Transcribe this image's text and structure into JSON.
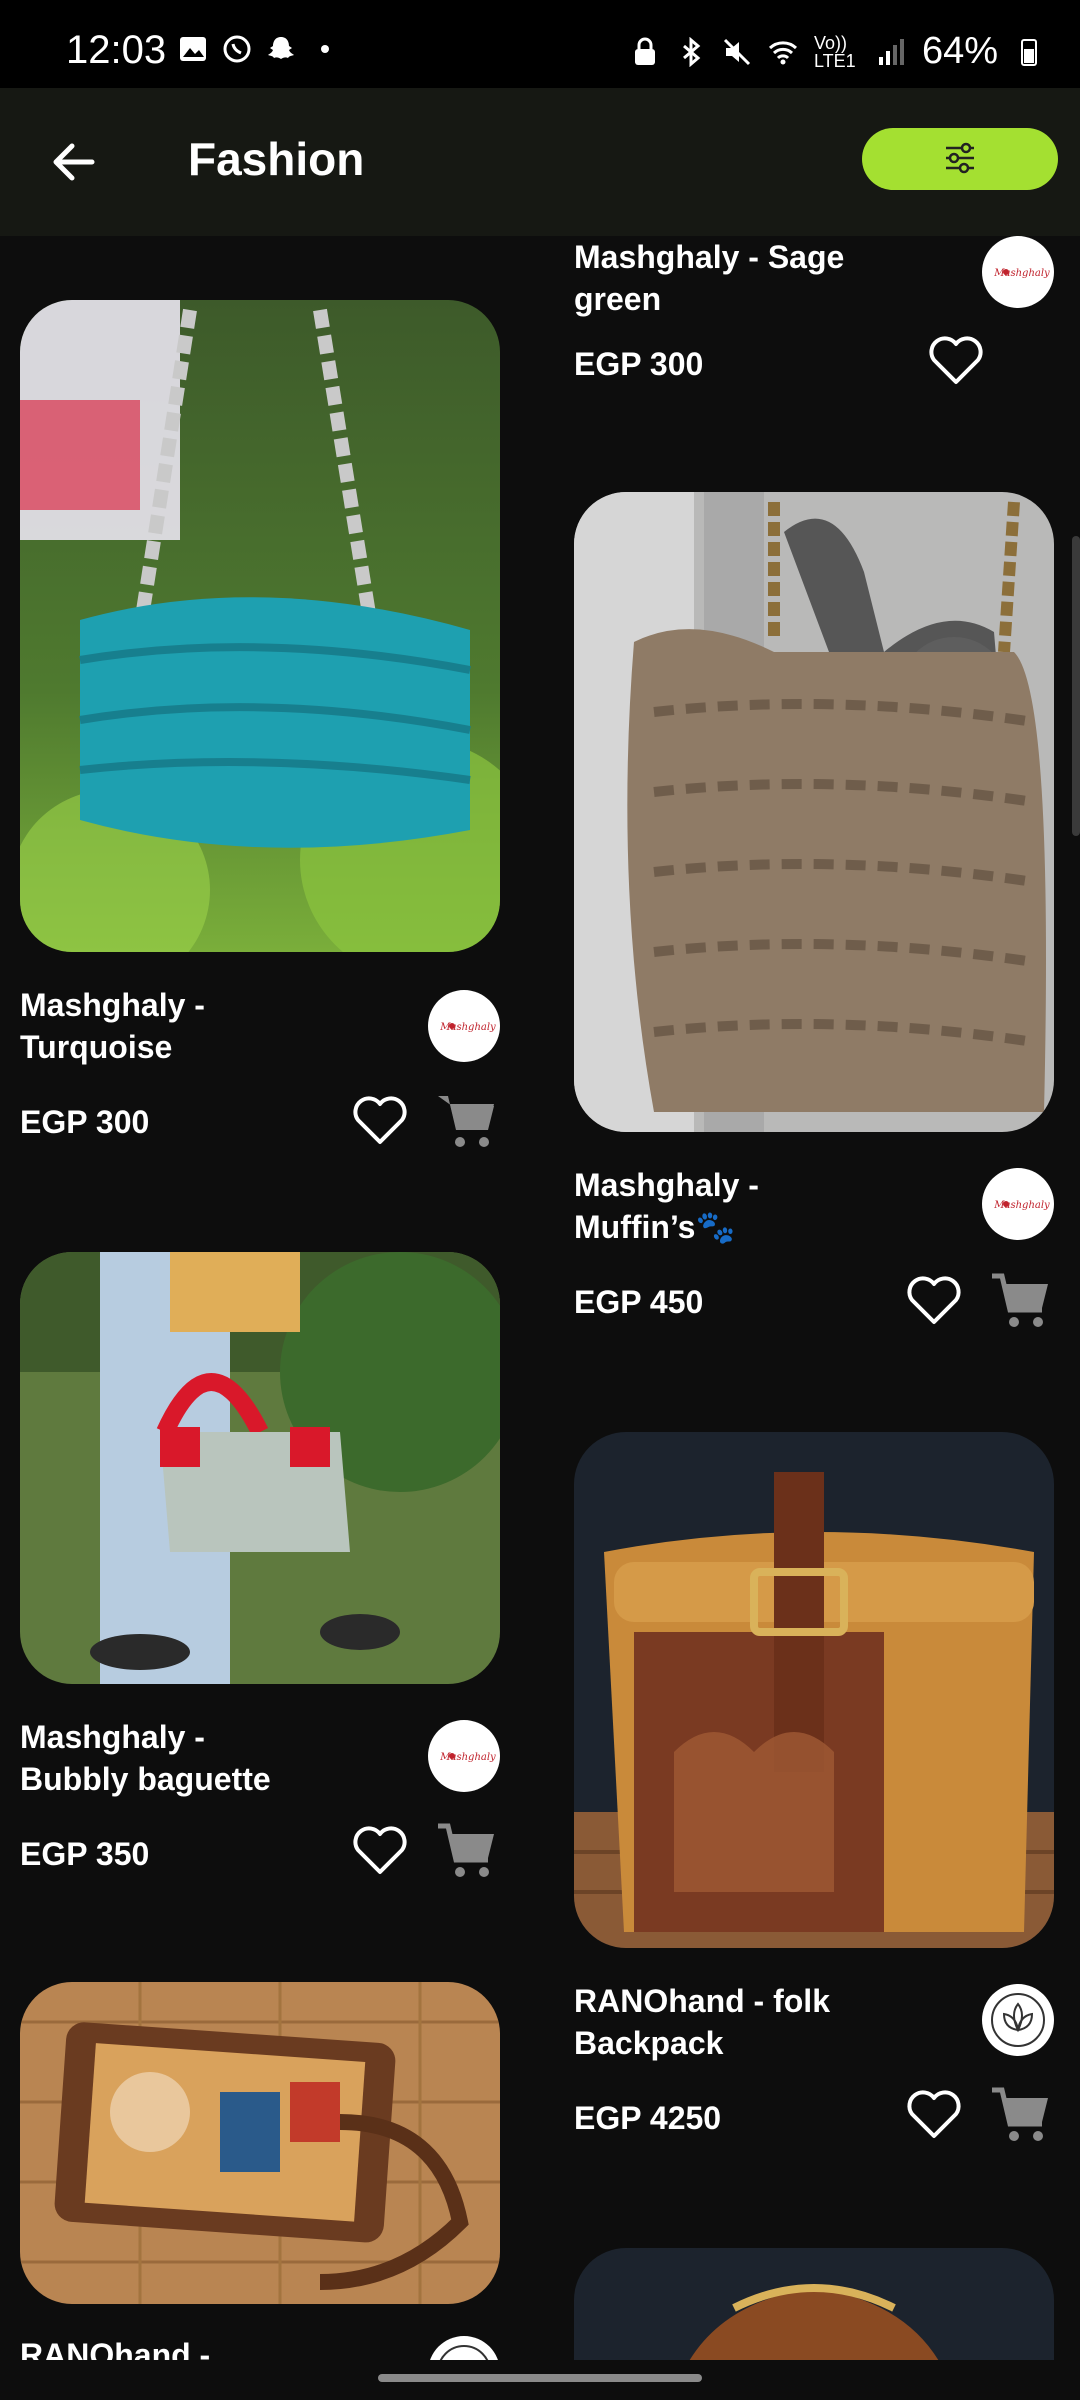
{
  "status_bar": {
    "time": "12:03",
    "battery": "64%",
    "network": "Vo)) LTE1"
  },
  "app_bar": {
    "title": "Fashion",
    "back_icon": "arrow-left-icon",
    "filter_icon": "sliders-icon"
  },
  "colors": {
    "background": "#0d0d0d",
    "appbar": "#161813",
    "accent": "#a4e031",
    "text": "#ffffff"
  },
  "products": [
    {
      "name_line1": "Mashghaly - Sage",
      "name_line2": "green",
      "price": "EGP 300",
      "brand": "Mashghaly"
    },
    {
      "name_line1": "Mashghaly -",
      "name_line2": "Turquoise",
      "price": "EGP 300",
      "brand": "Mashghaly"
    },
    {
      "name_line1": "Mashghaly -",
      "name_line2": "Muffin’s🐾",
      "price": "EGP 450",
      "brand": "Mashghaly"
    },
    {
      "name_line1": "Mashghaly -",
      "name_line2": "Bubbly baguette",
      "price": "EGP 350",
      "brand": "Mashghaly"
    },
    {
      "name_line1": "RANOhand - folk",
      "name_line2": "Backpack",
      "price": "EGP 4250",
      "brand": "RANOhand"
    },
    {
      "name_line1": "RANOhand -",
      "name_line2": "",
      "price": "",
      "brand": "RANOhand"
    }
  ],
  "brand_logo_text": "Mashghaly"
}
